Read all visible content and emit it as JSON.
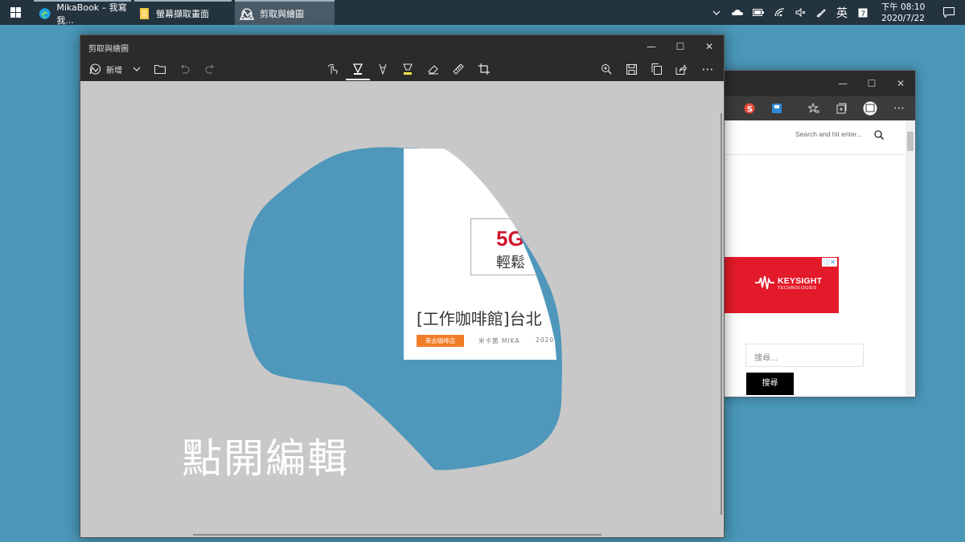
{
  "taskbar": {
    "apps": [
      {
        "label": "MikaBook – 我寫我...",
        "icon": "edge-icon"
      },
      {
        "label": "螢幕擷取畫面",
        "icon": "folder-icon"
      },
      {
        "label": "剪取與繪圖",
        "icon": "snip-sketch-icon",
        "active": true
      }
    ],
    "tray": {
      "ime": "英",
      "time": "下午 08:10",
      "date": "2020/7/22"
    }
  },
  "snip_window": {
    "title": "剪取與繪圖",
    "new_label": "新增",
    "tools": [
      "touch-writing-icon",
      "ballpoint-pen-icon",
      "pencil-icon",
      "highlighter-icon",
      "eraser-icon",
      "ruler-icon",
      "crop-icon"
    ],
    "actions": [
      "zoom-icon",
      "save-icon",
      "copy-icon",
      "share-icon",
      "more-icon"
    ],
    "annotation_text": "點開編輯",
    "card": {
      "ad_line1": "5G",
      "ad_line2": "輕鬆",
      "title": "[工作咖啡館]台北",
      "tag": "來去咖啡店",
      "author": "米卡菌 MIKA",
      "date": "2020"
    }
  },
  "browser_window": {
    "search_placeholder": "Search and hit enter...",
    "ad_brand": "KEYSIGHT",
    "ad_sub": "TECHNOLOGIES",
    "ad_close": "ⓘ✕",
    "sidebar_search_placeholder": "搜尋...",
    "sidebar_search_button": "搜尋"
  },
  "colors": {
    "desktop": "#4a97b8",
    "highlight_blue": "#4a97b8",
    "canvas": "#c8c8c8",
    "tag_orange": "#f27d29",
    "ad_red": "#e31a2a"
  }
}
